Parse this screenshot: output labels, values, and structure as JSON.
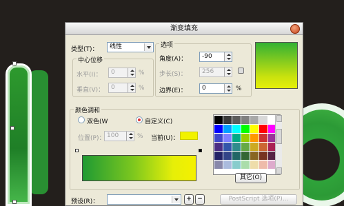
{
  "dialog": {
    "title": "渐变填充",
    "type_label": "类型(T)：",
    "type_value": "线性",
    "center_group_title": "中心位移",
    "horizontal_label": "水平(I)：",
    "horizontal_value": "0",
    "vertical_label": "垂直(V)：",
    "vertical_value": "0",
    "percent": "%",
    "options_group_title": "选项",
    "angle_label": "角度(A)：",
    "angle_value": "-90",
    "steps_label": "步长(S)：",
    "steps_value": "256",
    "edge_label": "边界(E)：",
    "edge_value": "0",
    "blend_group_title": "颜色调和",
    "two_color_label": "双色(W",
    "custom_label": "自定义(C)",
    "position_label": "位置(P)：",
    "position_value": "100",
    "current_label": "当前(U)：",
    "other_button": "其它(O)",
    "preset_label": "预设(R)：",
    "preset_value": "",
    "postscript_button": "PostScript 选项(P)...",
    "current_color": "#f2f200"
  },
  "palette": [
    "#000000",
    "#3a3a3a",
    "#5c5c5c",
    "#808080",
    "#a8a8a8",
    "#d8d8d8",
    "#ffffff",
    "#0000ff",
    "#00a0ff",
    "#00ffff",
    "#00ff00",
    "#ffff00",
    "#ff0000",
    "#ff00ff",
    "#3f48cc",
    "#7f7fff",
    "#00aa88",
    "#99cc00",
    "#ff9900",
    "#cc3333",
    "#993399",
    "#4b2d84",
    "#3355aa",
    "#2f8c8c",
    "#66aa44",
    "#ccaa22",
    "#cc6633",
    "#aa2255",
    "#222266",
    "#334488",
    "#226666",
    "#336633",
    "#886622",
    "#773322",
    "#552244",
    "#8888aa",
    "#aabbdd",
    "#88cccc",
    "#aaddaa",
    "#eeddaa",
    "#eebbaa",
    "#ddaacc"
  ]
}
